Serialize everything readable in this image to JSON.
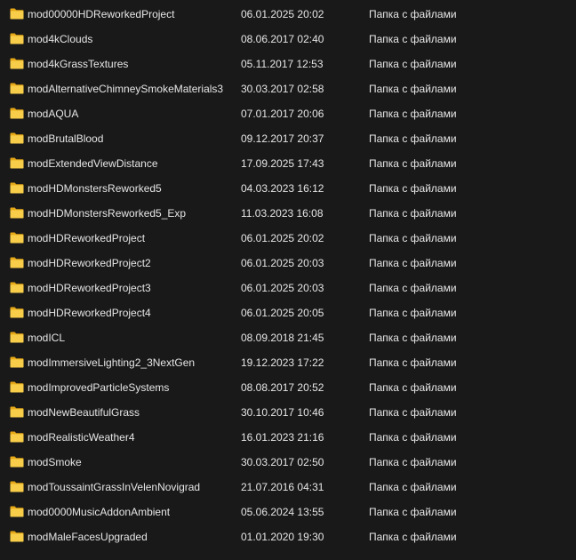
{
  "icon": "folder-icon",
  "colors": {
    "background": "#191919",
    "text": "#e6e6e6",
    "folder_back": "#e6a817",
    "folder_front": "#f8cd49"
  },
  "files": [
    {
      "name": "mod00000HDReworkedProject",
      "modified": "06.01.2025 20:02",
      "type": "Папка с файлами"
    },
    {
      "name": "mod4kClouds",
      "modified": "08.06.2017 02:40",
      "type": "Папка с файлами"
    },
    {
      "name": "mod4kGrassTextures",
      "modified": "05.11.2017 12:53",
      "type": "Папка с файлами"
    },
    {
      "name": "modAlternativeChimneySmokeMaterials3",
      "modified": "30.03.2017 02:58",
      "type": "Папка с файлами"
    },
    {
      "name": "modAQUA",
      "modified": "07.01.2017 20:06",
      "type": "Папка с файлами"
    },
    {
      "name": "modBrutalBlood",
      "modified": "09.12.2017 20:37",
      "type": "Папка с файлами"
    },
    {
      "name": "modExtendedViewDistance",
      "modified": "17.09.2025 17:43",
      "type": "Папка с файлами"
    },
    {
      "name": "modHDMonstersReworked5",
      "modified": "04.03.2023 16:12",
      "type": "Папка с файлами"
    },
    {
      "name": "modHDMonstersReworked5_Exp",
      "modified": "11.03.2023 16:08",
      "type": "Папка с файлами"
    },
    {
      "name": "modHDReworkedProject",
      "modified": "06.01.2025 20:02",
      "type": "Папка с файлами"
    },
    {
      "name": "modHDReworkedProject2",
      "modified": "06.01.2025 20:03",
      "type": "Папка с файлами"
    },
    {
      "name": "modHDReworkedProject3",
      "modified": "06.01.2025 20:03",
      "type": "Папка с файлами"
    },
    {
      "name": "modHDReworkedProject4",
      "modified": "06.01.2025 20:05",
      "type": "Папка с файлами"
    },
    {
      "name": "modICL",
      "modified": "08.09.2018 21:45",
      "type": "Папка с файлами"
    },
    {
      "name": "modImmersiveLighting2_3NextGen",
      "modified": "19.12.2023 17:22",
      "type": "Папка с файлами"
    },
    {
      "name": "modImprovedParticleSystems",
      "modified": "08.08.2017 20:52",
      "type": "Папка с файлами"
    },
    {
      "name": "modNewBeautifulGrass",
      "modified": "30.10.2017 10:46",
      "type": "Папка с файлами"
    },
    {
      "name": "modRealisticWeather4",
      "modified": "16.01.2023 21:16",
      "type": "Папка с файлами"
    },
    {
      "name": "modSmoke",
      "modified": "30.03.2017 02:50",
      "type": "Папка с файлами"
    },
    {
      "name": "modToussaintGrassInVelenNovigrad",
      "modified": "21.07.2016 04:31",
      "type": "Папка с файлами"
    },
    {
      "name": "mod0000MusicAddonAmbient",
      "modified": "05.06.2024 13:55",
      "type": "Папка с файлами"
    },
    {
      "name": "modMaleFacesUpgraded",
      "modified": "01.01.2020 19:30",
      "type": "Папка с файлами"
    }
  ]
}
